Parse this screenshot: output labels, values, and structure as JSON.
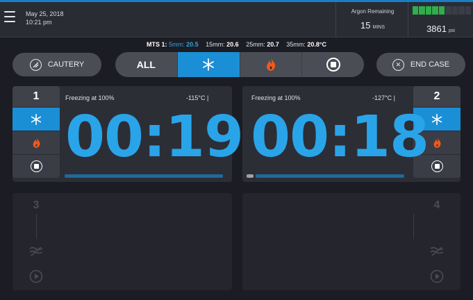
{
  "header": {
    "date": "May 25, 2018",
    "time": "10:21 pm",
    "argon_label": "Argon Remaining",
    "argon_value": "15",
    "argon_unit": "MINS",
    "pressure_value": "3861",
    "pressure_unit": "psi",
    "pressure_gauge_level": 0.56
  },
  "mts": {
    "label": "MTS 1:",
    "readings": [
      {
        "depth": "5mm:",
        "value": "20.5"
      },
      {
        "depth": "15mm:",
        "value": "20.6"
      },
      {
        "depth": "25mm:",
        "value": "20.7"
      },
      {
        "depth": "35mm:",
        "value": "20.8°C"
      }
    ]
  },
  "controls": {
    "cautery_label": "CAUTERY",
    "all_label": "ALL",
    "end_case_label": "END CASE"
  },
  "probes": [
    {
      "number": "1",
      "status": "Freezing at 100%",
      "temp": "-115°C |",
      "timer": "00:19"
    },
    {
      "number": "2",
      "status": "Freezing at 100%",
      "temp": "-127°C |",
      "timer": "00:18"
    },
    {
      "number": "3"
    },
    {
      "number": "4"
    }
  ],
  "colors": {
    "accent": "#1a8fd6",
    "timer": "#2aa4e8",
    "flame": "#f05a1a",
    "gauge_on": "#2fae4a"
  },
  "icons": [
    "menu-icon",
    "cautery-icon",
    "snowflake-icon",
    "flame-icon",
    "stop-icon",
    "close-icon",
    "thaw-icon",
    "play-icon"
  ]
}
